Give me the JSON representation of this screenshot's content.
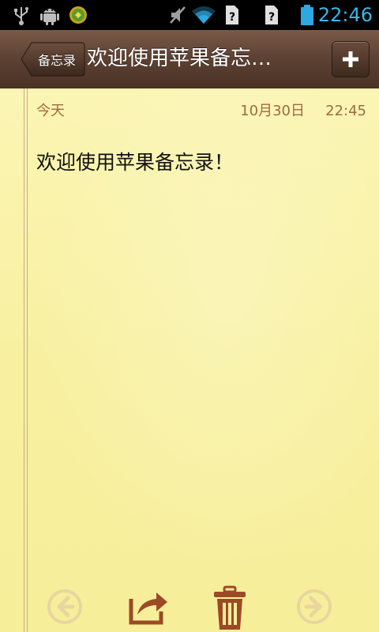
{
  "status_bar": {
    "time": "22:46",
    "icons": [
      "usb-icon",
      "android-debug-icon",
      "app-notification-icon",
      "muted-icon",
      "wifi-icon",
      "no-sim-icon",
      "no-sim-icon",
      "battery-icon"
    ]
  },
  "titlebar": {
    "back_label": "备忘录",
    "title": "欢迎使用苹果备忘…"
  },
  "note": {
    "day": "今天",
    "date": "10月30日",
    "time": "22:45",
    "body": "欢迎使用苹果备忘录！"
  },
  "toolbar": {
    "icons": [
      "previous-arrow-icon",
      "share-icon",
      "trash-icon",
      "next-arrow-icon"
    ]
  },
  "colors": {
    "titlebar": "#5e4334",
    "paper": "#f8f0a0",
    "date_text": "#a06a3f",
    "toolbar_icon": "#9c4a26",
    "toolbar_icon_disabled": "#e6d4a0",
    "clock": "#37b8e8"
  }
}
